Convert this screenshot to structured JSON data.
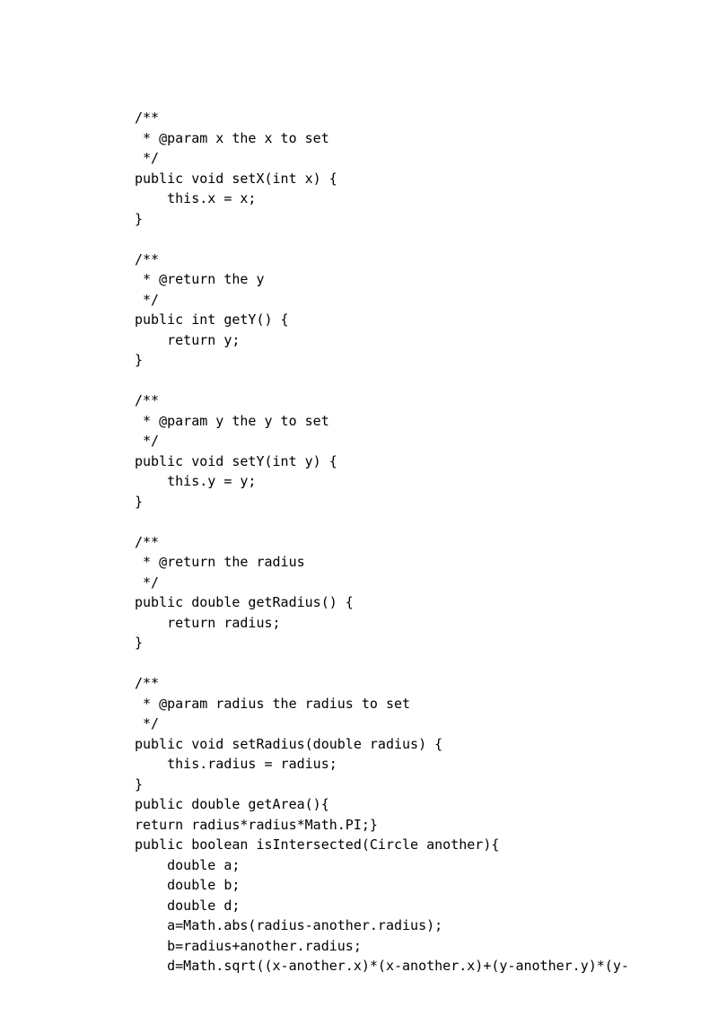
{
  "code_lines": [
    "/**",
    " * @param x the x to set",
    " */",
    "public void setX(int x) {",
    "    this.x = x;",
    "}",
    "",
    "/**",
    " * @return the y",
    " */",
    "public int getY() {",
    "    return y;",
    "}",
    "",
    "/**",
    " * @param y the y to set",
    " */",
    "public void setY(int y) {",
    "    this.y = y;",
    "}",
    "",
    "/**",
    " * @return the radius",
    " */",
    "public double getRadius() {",
    "    return radius;",
    "}",
    "",
    "/**",
    " * @param radius the radius to set",
    " */",
    "public void setRadius(double radius) {",
    "    this.radius = radius;",
    "}",
    "public double getArea(){",
    "return radius*radius*Math.PI;}",
    "public boolean isIntersected(Circle another){",
    "    double a;",
    "    double b;",
    "    double d;",
    "    a=Math.abs(radius-another.radius);",
    "    b=radius+another.radius;",
    "    d=Math.sqrt((x-another.x)*(x-another.x)+(y-another.y)*(y-"
  ]
}
